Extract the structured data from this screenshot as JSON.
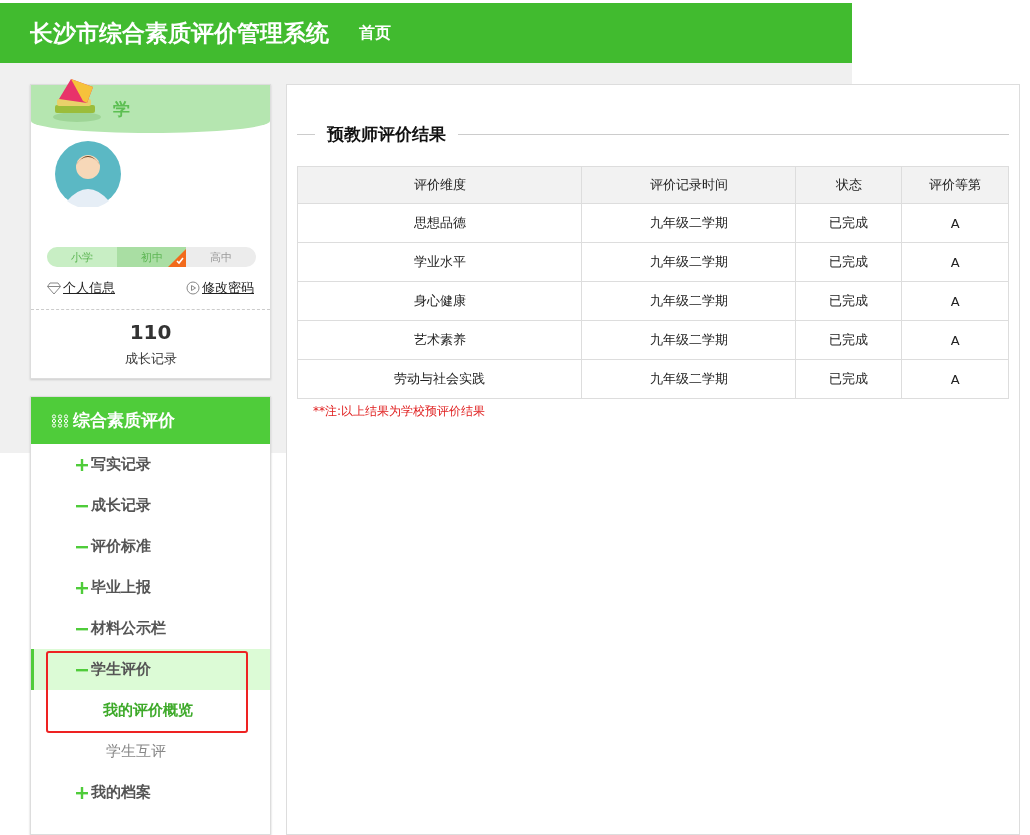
{
  "header": {
    "title": "长沙市综合素质评价管理系统",
    "nav": [
      {
        "label": "首页",
        "selected": false
      }
    ]
  },
  "profile": {
    "banner_title": "学",
    "stages": [
      {
        "label": "小学",
        "selected": false
      },
      {
        "label": "初中",
        "selected": true
      },
      {
        "label": "高中",
        "selected": false
      }
    ],
    "links": [
      {
        "kind": "info",
        "label": "个人信息"
      },
      {
        "kind": "password",
        "label": "修改密码"
      }
    ],
    "count": "110",
    "count_label": "成长记录"
  },
  "menu": {
    "title": "综合素质评价",
    "items": [
      {
        "label": "写实记录",
        "expanded": false,
        "selected": false,
        "highlighted": false
      },
      {
        "label": "成长记录",
        "expanded": true,
        "selected": false,
        "highlighted": false
      },
      {
        "label": "评价标准",
        "expanded": true,
        "selected": false,
        "highlighted": false
      },
      {
        "label": "毕业上报",
        "expanded": false,
        "selected": false,
        "highlighted": false
      },
      {
        "label": "材料公示栏",
        "expanded": true,
        "selected": false,
        "highlighted": false
      },
      {
        "label": "学生评价",
        "expanded": true,
        "selected": true,
        "highlighted": true,
        "children": [
          {
            "label": "我的评价概览",
            "selected": true
          }
        ]
      },
      {
        "label": "学生互评",
        "selected": false,
        "sub": true
      },
      {
        "label": "我的档案",
        "expanded": false,
        "selected": false,
        "highlighted": false
      }
    ]
  },
  "main": {
    "section_title": "预教师评价结果",
    "table": {
      "columns": [
        "评价维度",
        "评价记录时间",
        "状态",
        "评价等第"
      ],
      "rows": [
        [
          "思想品德",
          "九年级二学期",
          "已完成",
          "A"
        ],
        [
          "学业水平",
          "九年级二学期",
          "已完成",
          "A"
        ],
        [
          "身心健康",
          "九年级二学期",
          "已完成",
          "A"
        ],
        [
          "艺术素养",
          "九年级二学期",
          "已完成",
          "A"
        ],
        [
          "劳动与社会实践",
          "九年级二学期",
          "已完成",
          "A"
        ]
      ]
    },
    "note": "**注:以上结果为学校预评价结果"
  }
}
